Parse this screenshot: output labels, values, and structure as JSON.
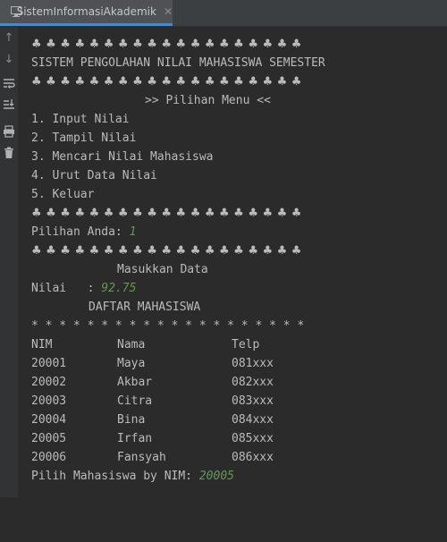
{
  "tab": {
    "title": "SistemInformasiAkademik",
    "close": "✕"
  },
  "gutter_icons": [
    "arrow-up-icon",
    "arrow-down-icon",
    "soft-wrap-icon",
    "scroll-to-end-icon",
    "print-icon",
    "trash-icon"
  ],
  "console": {
    "separator": "♣♣♣♣♣♣♣♣♣♣♣♣♣♣♣♣♣♣♣",
    "header_title": "SISTEM PENGOLAHAN NILAI MAHASISWA SEMESTER",
    "menu_title": ">> Pilihan Menu <<",
    "menu_items": [
      "1. Input Nilai",
      "2. Tampil Nilai",
      "3. Mencari Nilai Mahasiswa",
      "4. Urut Data Nilai",
      "5. Keluar"
    ],
    "choice_prompt": "Pilihan Anda: ",
    "choice_value": "1",
    "input_header": "Masukkan Data",
    "nilai_prompt": "Nilai   : ",
    "nilai_value": "92.75",
    "list_title": "DAFTAR MAHASISWA",
    "star_row": "* * * * * * * * * * * * * * * * * * * *",
    "table_headers": [
      "NIM",
      "Nama",
      "Telp"
    ],
    "table_rows": [
      [
        "20001",
        "Maya",
        "081xxx"
      ],
      [
        "20002",
        "Akbar",
        "082xxx"
      ],
      [
        "20003",
        "Citra",
        "083xxx"
      ],
      [
        "20004",
        "Bina",
        "084xxx"
      ],
      [
        "20005",
        "Irfan",
        "085xxx"
      ],
      [
        "20006",
        "Fansyah",
        "086xxx"
      ]
    ],
    "select_prompt": "Pilih Mahasiswa by NIM: ",
    "select_value": "20005"
  }
}
